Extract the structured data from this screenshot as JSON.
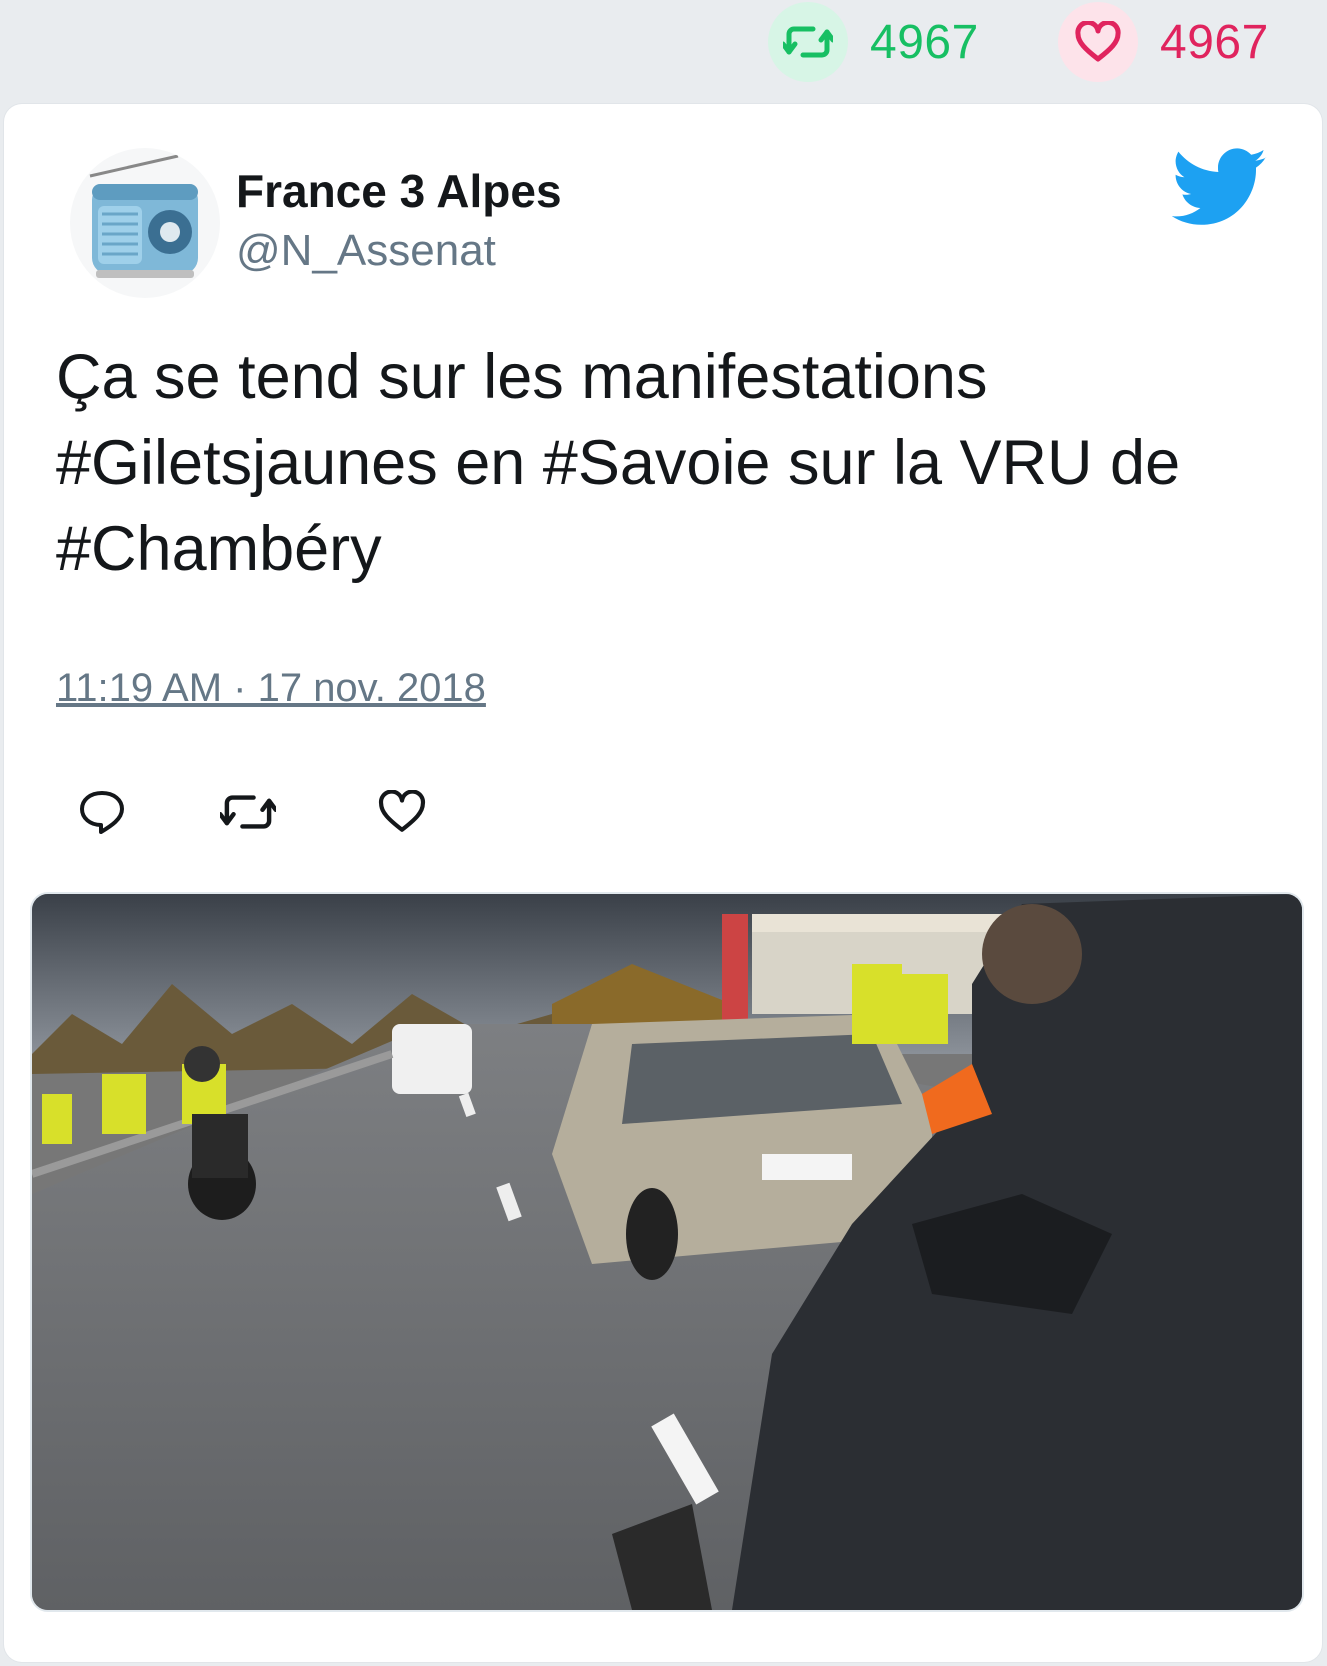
{
  "stats": {
    "retweet_count": "4967",
    "like_count": "4967",
    "retweet_icon": "retweet-icon",
    "like_icon": "heart-icon"
  },
  "tweet": {
    "author_name": "France 3 Alpes",
    "author_handle": "@N_Assenat",
    "avatar": "radio-avatar",
    "text_lines": [
      "Ça se tend sur les manifestations",
      "#Giletsjaunes en #Savoie sur la VRU de",
      "#Chambéry"
    ],
    "timestamp": "11:19 AM · 17 nov. 2018",
    "media": "protest-highway-photo"
  },
  "actions": {
    "reply_icon": "reply-icon",
    "retweet_icon": "retweet-icon",
    "like_icon": "heart-icon"
  },
  "colors": {
    "retweet_green": "#17bf63",
    "like_red": "#e0245e",
    "twitter_blue": "#1da1f2",
    "secondary_text": "#657786"
  }
}
